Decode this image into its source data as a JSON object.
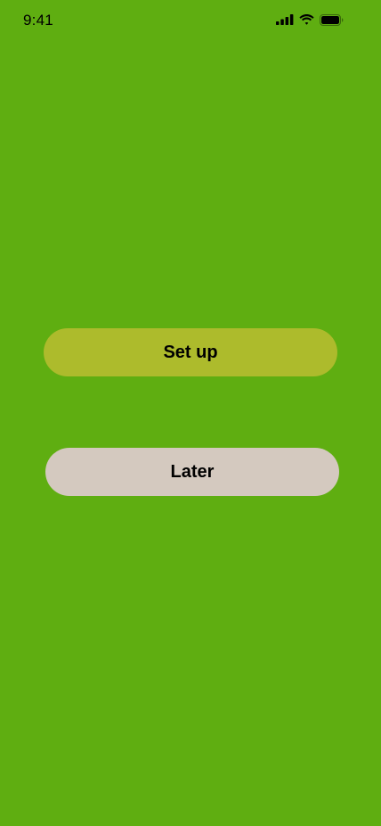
{
  "status_bar": {
    "time": "9:41",
    "icons": [
      "cellular-signal-icon",
      "wifi-icon",
      "battery-icon"
    ]
  },
  "actions": {
    "setup_label": "Set up",
    "later_label": "Later"
  },
  "colors": {
    "background": "#5fae11",
    "setup_button": "#adbb2c",
    "later_button": "#d4c9bf",
    "text": "#000000"
  }
}
